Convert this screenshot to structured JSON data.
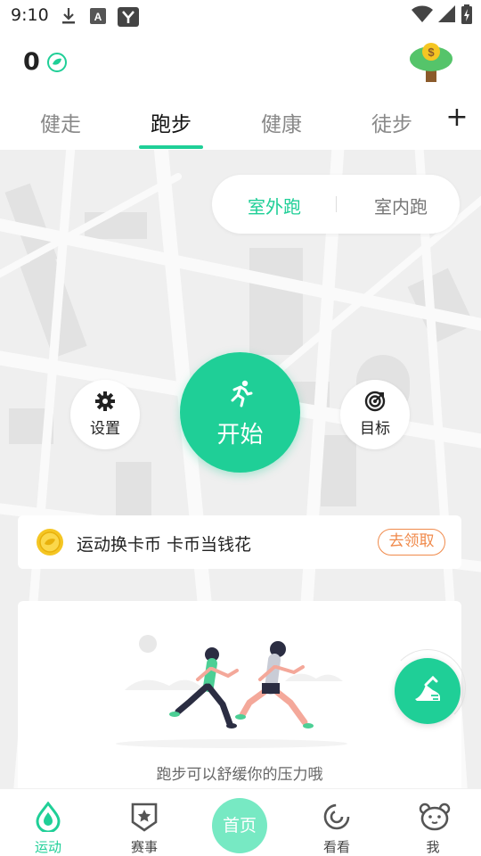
{
  "status_bar": {
    "time": "9:10",
    "icons": [
      "download-icon",
      "font-a-icon",
      "app-y-icon",
      "wifi-icon",
      "signal-icon",
      "battery-charging-icon"
    ]
  },
  "header": {
    "coin_count": "0",
    "coin_icon": "leaf-coin-icon",
    "tree_icon": "money-tree-icon"
  },
  "tabs": {
    "items": [
      {
        "label": "健走"
      },
      {
        "label": "跑步"
      },
      {
        "label": "健康"
      },
      {
        "label": "徒步"
      }
    ],
    "active_index": 1,
    "add_label": "+"
  },
  "run_mode": {
    "outdoor": "室外跑",
    "indoor": "室内跑",
    "active": "outdoor"
  },
  "controls": {
    "settings_label": "设置",
    "start_label": "开始",
    "goal_label": "目标"
  },
  "promo": {
    "text": "运动换卡币 卡币当钱花",
    "claim_label": "去领取"
  },
  "card": {
    "caption": "跑步可以舒缓你的压力哦"
  },
  "bottom_nav": {
    "items": [
      {
        "label": "运动",
        "icon": "drop-icon",
        "active": true
      },
      {
        "label": "赛事",
        "icon": "badge-star-icon",
        "active": false
      },
      {
        "label": "首页",
        "icon": "home-icon",
        "active": false
      },
      {
        "label": "看看",
        "icon": "spiral-icon",
        "active": false
      },
      {
        "label": "我",
        "icon": "bear-face-icon",
        "active": false
      }
    ]
  },
  "colors": {
    "accent": "#1fcf97",
    "promo_orange": "#f08a4b",
    "map_bg": "#efefef"
  }
}
